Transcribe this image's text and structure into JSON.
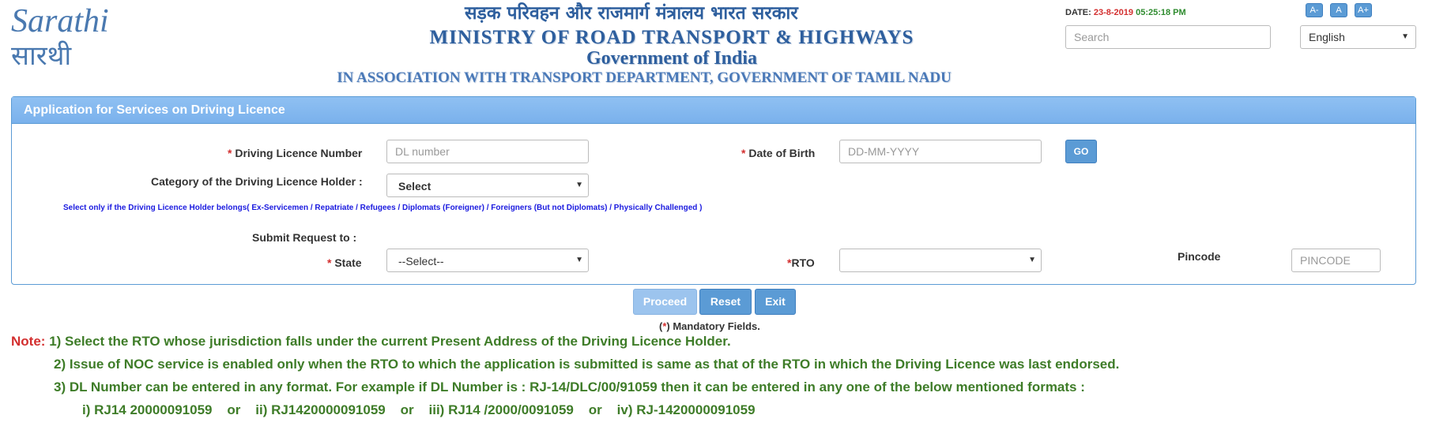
{
  "header": {
    "logo_text_en": "Sarathi",
    "logo_text_hi": "सारथी",
    "hindi_title": "सड़क परिवहन और राजमार्ग मंत्रालय भारत सरकार",
    "ministry": "MINISTRY OF ROAD TRANSPORT & HIGHWAYS",
    "government": "Government of India",
    "association": "IN ASSOCIATION WITH TRANSPORT DEPARTMENT, GOVERNMENT OF TAMIL NADU",
    "date_label": "DATE:",
    "date_value": "23-8-2019",
    "time_value": "05:25:18 PM",
    "search_placeholder": "Search",
    "font_small": "A-",
    "font_normal": "A",
    "font_large": "A+",
    "language": "English"
  },
  "panel": {
    "title": "Application for Services on Driving Licence",
    "dl_number_label": "Driving Licence Number",
    "dl_number_placeholder": "DL number",
    "dob_label": "Date of Birth",
    "dob_placeholder": "DD-MM-YYYY",
    "go_label": "GO",
    "category_label": "Category of the Driving Licence Holder :",
    "category_value": "Select",
    "category_hint": "Select only if the Driving Licence Holder belongs( Ex-Servicemen / Repatriate / Refugees / Diplomats (Foreigner) / Foreigners (But not Diplomats) / Physically Challenged )",
    "submit_to_label": "Submit Request to :",
    "state_label": "State",
    "state_value": "--Select--",
    "rto_label": "RTO",
    "rto_value": "",
    "pincode_label": "Pincode",
    "pincode_placeholder": "PINCODE",
    "required_mark": "*"
  },
  "actions": {
    "proceed": "Proceed",
    "reset": "Reset",
    "exit": "Exit",
    "mandatory_open": "(",
    "mandatory_star": "*",
    "mandatory_text": ") Mandatory Fields."
  },
  "notes": {
    "label": "Note:",
    "n1": "1) Select the RTO whose jurisdiction falls under the current Present Address of the Driving Licence Holder.",
    "n2": "2) Issue of NOC service is enabled only when the RTO to which the application is submitted is same as that of the RTO in which the Driving Licence was last endorsed.",
    "n3": "3) DL Number can be entered in any format. For example if DL Number is : RJ-14/DLC/00/91059 then it can be entered in any one of the below mentioned formats :",
    "n4": "i) RJ14 20000091059    or    ii) RJ1420000091059    or    iii) RJ14 /2000/0091059    or    iv) RJ-1420000091059"
  },
  "colors": {
    "accent": "#5b9bd5",
    "panel_header": "#86baf0",
    "required": "#d32f2f",
    "note_text": "#3e7c28",
    "hint_text": "#1a1adf",
    "header_blue": "#2e5f9e"
  }
}
